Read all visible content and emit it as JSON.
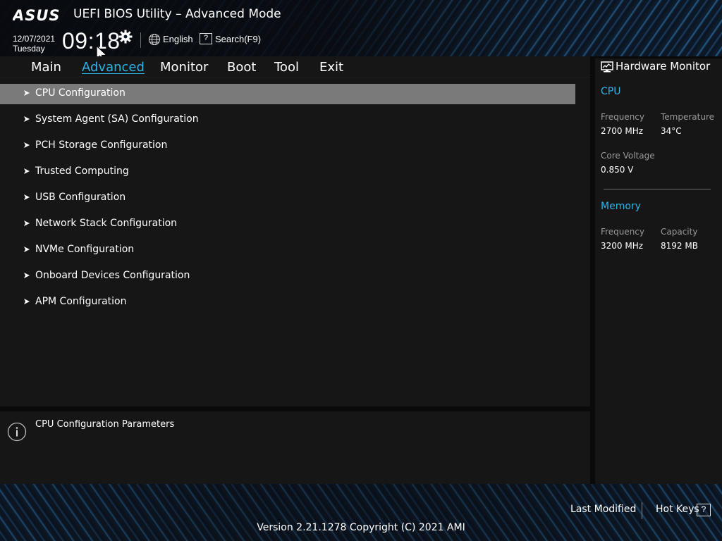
{
  "header": {
    "brand": "ASUS",
    "title": "UEFI BIOS Utility – Advanced Mode",
    "date": "12/07/2021",
    "weekday": "Tuesday",
    "time": "09:18",
    "language": "English",
    "search_key": "?",
    "search_label": "Search(F9)"
  },
  "nav": {
    "tabs": [
      "Main",
      "Advanced",
      "Monitor",
      "Boot",
      "Tool",
      "Exit"
    ],
    "active": "Advanced"
  },
  "menu": {
    "items": [
      "CPU Configuration",
      "System Agent (SA) Configuration",
      "PCH Storage Configuration",
      "Trusted Computing",
      "USB Configuration",
      "Network Stack Configuration",
      "NVMe Configuration",
      "Onboard Devices Configuration",
      "APM Configuration"
    ],
    "selected": "CPU Configuration"
  },
  "info": {
    "text": "CPU Configuration Parameters"
  },
  "hardware_monitor": {
    "title": "Hardware Monitor",
    "cpu": {
      "heading": "CPU",
      "frequency_label": "Frequency",
      "frequency": "2700 MHz",
      "temperature_label": "Temperature",
      "temperature": "34°C",
      "voltage_label": "Core Voltage",
      "voltage": "0.850 V"
    },
    "memory": {
      "heading": "Memory",
      "frequency_label": "Frequency",
      "frequency": "3200 MHz",
      "capacity_label": "Capacity",
      "capacity": "8192 MB"
    }
  },
  "footer": {
    "last_modified": "Last Modified",
    "hot_keys": "Hot Keys",
    "hot_keys_key": "?",
    "version": "Version 2.21.1278 Copyright (C) 2021 AMI"
  },
  "colors": {
    "accent": "#2fb4e6",
    "panel": "#161616",
    "selected_row": "#7a7a7a"
  },
  "icons": [
    "asus-logo",
    "gear-icon",
    "globe-icon",
    "help-icon",
    "arrow-icon",
    "info-icon",
    "monitor-icon",
    "mouse-cursor-icon"
  ]
}
